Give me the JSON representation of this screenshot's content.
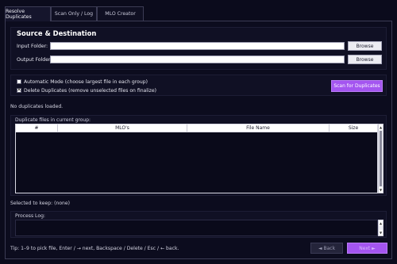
{
  "tabs": [
    {
      "label": "Resolve Duplicates",
      "active": true
    },
    {
      "label": "Scan Only / Log",
      "active": false
    },
    {
      "label": "MLO Creator",
      "active": false
    }
  ],
  "source": {
    "title": "Source & Destination",
    "input_label": "Input Folder:",
    "input_value": "",
    "output_label": "Output Folder:",
    "output_value": "",
    "browse_label": "Browse"
  },
  "options": {
    "auto_mode_label": "Automatic Mode (choose largest file in each group)",
    "auto_mode_checked": false,
    "delete_label": "Delete Duplicates (remove unselected files on finalize)",
    "delete_checked": true,
    "scan_button": "Scan for Duplicates"
  },
  "status_text": "No duplicates loaded.",
  "group": {
    "label": "Duplicate files in current group:",
    "columns": [
      "#",
      "MLO's",
      "File Name",
      "Size"
    ],
    "rows": []
  },
  "selected_text": "Selected to keep: (none)",
  "log": {
    "label": "Process Log:",
    "text": ""
  },
  "tip_text": "Tip: 1–9 to pick file, Enter / → next, Backspace / Delete / Esc / ← back.",
  "nav": {
    "back_label": "◄ Back",
    "next_label": "Next ►"
  },
  "colors": {
    "accent": "#a455f0",
    "background": "#0b0b1c"
  }
}
